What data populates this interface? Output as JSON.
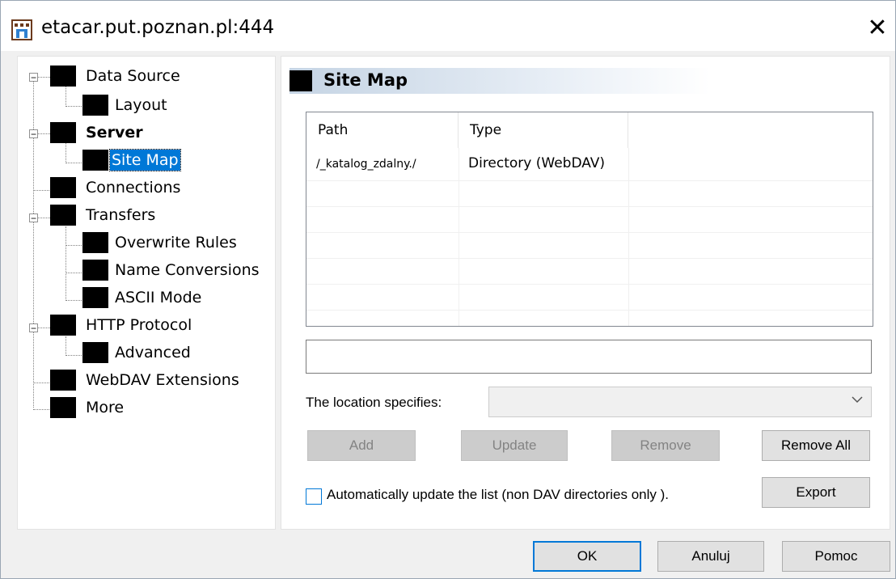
{
  "window": {
    "title": "etacar.put.poznan.pl:444",
    "close_glyph": "✕"
  },
  "tree": {
    "items": [
      {
        "label": "Data Source",
        "expander": "−"
      },
      {
        "label": "Layout"
      },
      {
        "label": "Server",
        "expander": "−"
      },
      {
        "label": "Site Map"
      },
      {
        "label": "Connections"
      },
      {
        "label": "Transfers",
        "expander": "−"
      },
      {
        "label": "Overwrite Rules"
      },
      {
        "label": "Name Conversions"
      },
      {
        "label": "ASCII Mode"
      },
      {
        "label": "HTTP Protocol",
        "expander": "−"
      },
      {
        "label": "Advanced"
      },
      {
        "label": "WebDAV Extensions"
      },
      {
        "label": "More"
      }
    ]
  },
  "panel": {
    "title": "Site Map"
  },
  "grid": {
    "columns": [
      "Path",
      "Type"
    ],
    "rows": [
      {
        "path": "/_katalog_zdalny./",
        "type": "Directory (WebDAV)"
      }
    ]
  },
  "path_input": {
    "value": ""
  },
  "location": {
    "label": "The location specifies:",
    "value": ""
  },
  "buttons": {
    "add": "Add",
    "update": "Update",
    "remove": "Remove",
    "remove_all": "Remove All",
    "export": "Export",
    "ok": "OK",
    "cancel": "Anuluj",
    "help": "Pomoc"
  },
  "auto_update": {
    "label": "Automatically update the list (non DAV directories only ).",
    "checked": false
  }
}
